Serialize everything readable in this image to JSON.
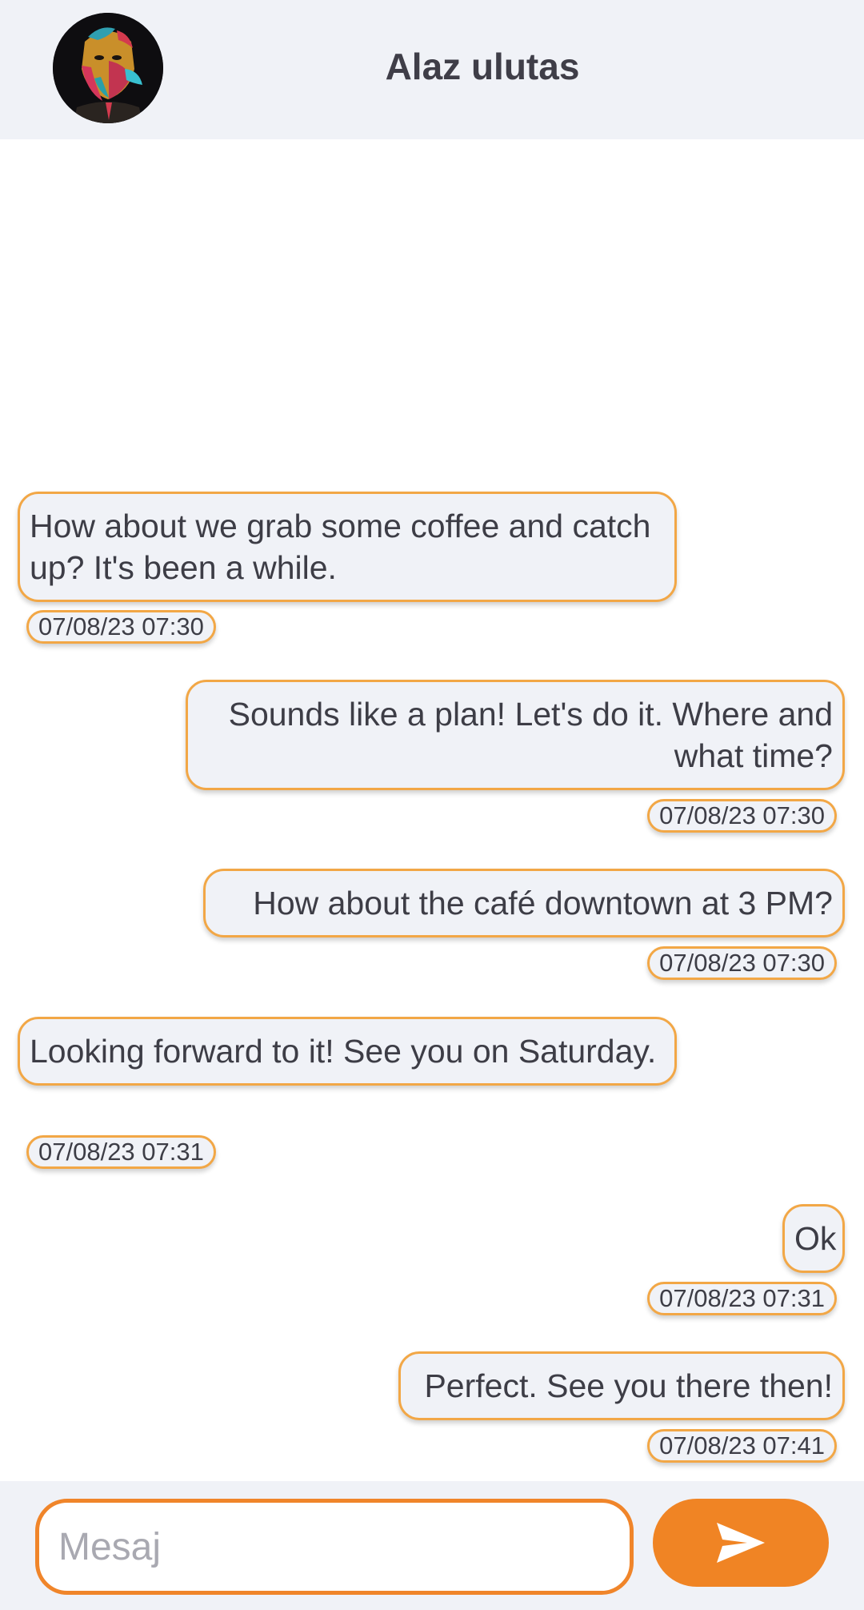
{
  "header": {
    "contact_name": "Alaz ulutas"
  },
  "messages": [
    {
      "side": "left",
      "text": "How about we grab some coffee and catch up? It's been a while.",
      "time": "07/08/23 07:30"
    },
    {
      "side": "right",
      "text": "Sounds like a plan! Let's do it. Where and what time?",
      "time": "07/08/23 07:30"
    },
    {
      "side": "right",
      "text": "How about the café downtown at 3 PM?",
      "time": "07/08/23 07:30"
    },
    {
      "side": "left",
      "text": "Looking forward to it! See you on Saturday.",
      "time": "07/08/23 07:31"
    },
    {
      "side": "right",
      "text": "Ok",
      "time": "07/08/23 07:31"
    },
    {
      "side": "right",
      "text": "Perfect. See you there then!",
      "time": "07/08/23 07:41"
    }
  ],
  "composer": {
    "placeholder": "Mesaj",
    "value": "",
    "send_icon": "send-icon"
  },
  "colors": {
    "accent": "#f08424",
    "bubble_border": "#f2a746",
    "bubble_bg": "#f0f2f7",
    "header_bg": "#f0f2f7"
  }
}
